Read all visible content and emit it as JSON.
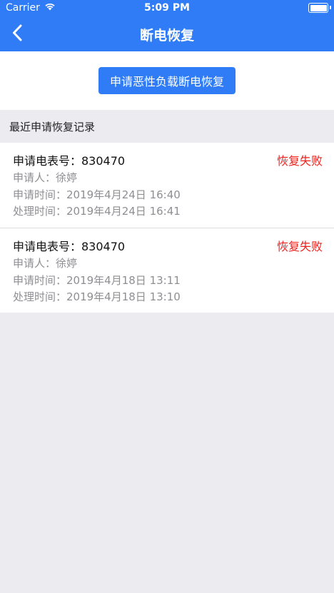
{
  "status_bar": {
    "carrier": "Carrier",
    "time": "5:09 PM",
    "wifi_icon": "wifi-icon",
    "battery_icon": "battery-icon"
  },
  "nav": {
    "back_icon": "chevron-left-icon",
    "title": "断电恢复"
  },
  "action": {
    "apply_button": "申请恶性负载断电恢复"
  },
  "section": {
    "title": "最近申请恢复记录"
  },
  "records": [
    {
      "meter": "申请电表号：830470",
      "status": "恢复失败",
      "applicant": "申请人：徐婷",
      "apply_time": "申请时间：2019年4月24日 16:40",
      "process_time": "处理时间：2019年4月24日 16:41"
    },
    {
      "meter": "申请电表号：830470",
      "status": "恢复失败",
      "applicant": "申请人：徐婷",
      "apply_time": "申请时间：2019年4月18日 13:11",
      "process_time": "处理时间：2019年4月18日 13:10"
    }
  ],
  "colors": {
    "primary": "#2f7cf6",
    "status_fail": "#f0201c",
    "secondary_text": "#8e8e93",
    "background": "#ebebf0"
  }
}
